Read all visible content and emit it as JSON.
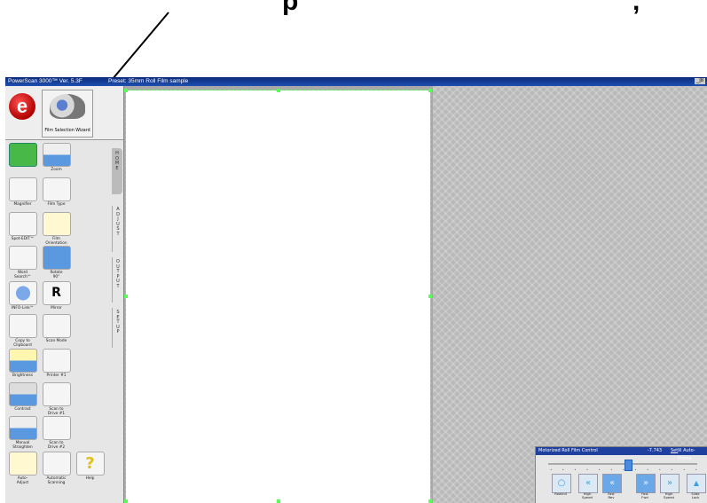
{
  "overlay": {
    "line1": "p",
    "line2": ","
  },
  "app": {
    "title": "PowerScan 3000™ Ver. 5.3F",
    "preset": "Preset: 35mm Roll Film sample",
    "window_controls": "_|8"
  },
  "wizard": {
    "label": "Film Selection Wizard"
  },
  "tabs": [
    {
      "label": "HOME",
      "active": true
    },
    {
      "label": "ADJUST",
      "active": false
    },
    {
      "label": "OUTPUT",
      "active": false
    },
    {
      "label": "SETUP",
      "active": false
    }
  ],
  "tools": {
    "zoom": "Zoom",
    "magnifier": "Magnifier",
    "film_type": "Film Type",
    "spot_edit": "Spot-EDIT™",
    "film_orientation": "Film\nOrientation",
    "word_search": "Word\nSearch™",
    "rotate": "Rotate\n90°",
    "info_link": "INFO-Link™",
    "mirror": "Mirror",
    "copy_clipboard": "Copy to\nClipboard",
    "scan_mode": "Scan Mode",
    "brightness": "Brightness",
    "printer": "Printer #1",
    "contrast": "Contrast",
    "scan_drive1": "Scan to\nDrive #1",
    "manual_straighten": "Manual\nStraighten",
    "scan_drive2": "Scan to\nDrive #2",
    "auto_adjust": "Auto-\nAdjust",
    "auto_scanning": "Automatic\nScanning",
    "help": "Help"
  },
  "film_control": {
    "title": "Motorized Roll Film Control",
    "value": "-7.743",
    "set": "Set",
    "auto_frame": "☒ Auto-Frame",
    "buttons": {
      "rewind": "Rewind",
      "high_speed_rev": "High\nSpeed",
      "fast_rev": "Fast\nRev",
      "fast_fwd": "Fast\nFwd",
      "high_speed_fwd": "High\nSpeed",
      "lock": "Slide\nLock"
    }
  },
  "colors": {
    "accent": "#2050b0",
    "frame": "#55ff55",
    "logo": "#c00000"
  }
}
